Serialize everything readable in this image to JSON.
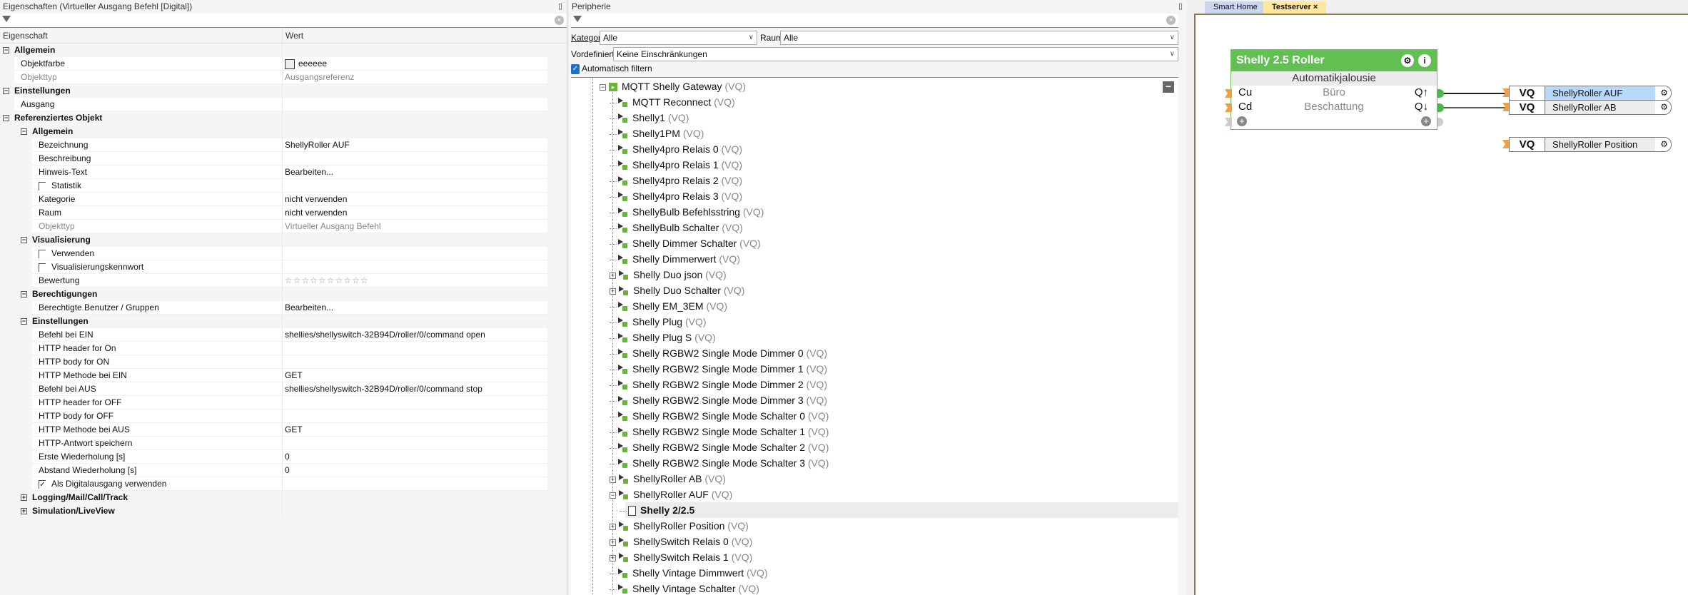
{
  "properties": {
    "title": "Eigenschaften (Virtueller Ausgang Befehl [Digital])",
    "col_property": "Eigenschaft",
    "col_value": "Wert",
    "rows": [
      {
        "type": "group",
        "level": 0,
        "label": "Allgemein",
        "toggle": "−"
      },
      {
        "type": "item",
        "level": 1,
        "label": "Objektfarbe",
        "value": "eeeeee",
        "swatch": "#eeeeee"
      },
      {
        "type": "item",
        "level": 1,
        "label": "Objekttyp",
        "value": "Ausgangsreferenz",
        "disabled": true
      },
      {
        "type": "group",
        "level": 0,
        "label": "Einstellungen",
        "toggle": "−"
      },
      {
        "type": "item",
        "level": 1,
        "label": "Ausgang",
        "value": ""
      },
      {
        "type": "group",
        "level": 0,
        "label": "Referenziertes Objekt",
        "toggle": "−"
      },
      {
        "type": "group",
        "level": 1,
        "label": "Allgemein",
        "toggle": "−"
      },
      {
        "type": "item",
        "level": 2,
        "label": "Bezeichnung",
        "value": "ShellyRoller AUF"
      },
      {
        "type": "item",
        "level": 2,
        "label": "Beschreibung",
        "value": ""
      },
      {
        "type": "item",
        "level": 2,
        "label": "Hinweis-Text",
        "value": "Bearbeiten..."
      },
      {
        "type": "item",
        "level": 2,
        "label": "Statistik",
        "value": "",
        "checkbox": false
      },
      {
        "type": "item",
        "level": 2,
        "label": "Kategorie",
        "value": "nicht verwenden"
      },
      {
        "type": "item",
        "level": 2,
        "label": "Raum",
        "value": "nicht verwenden"
      },
      {
        "type": "item",
        "level": 2,
        "label": "Objekttyp",
        "value": "Virtueller Ausgang Befehl",
        "disabled": true
      },
      {
        "type": "group",
        "level": 1,
        "label": "Visualisierung",
        "toggle": "−"
      },
      {
        "type": "item",
        "level": 2,
        "label": "Verwenden",
        "value": "",
        "checkbox": false
      },
      {
        "type": "item",
        "level": 2,
        "label": "Visualisierungskennwort",
        "value": "",
        "checkbox": false
      },
      {
        "type": "item",
        "level": 2,
        "label": "Bewertung",
        "value": "☆☆☆☆☆☆☆☆☆☆",
        "stars": true
      },
      {
        "type": "group",
        "level": 1,
        "label": "Berechtigungen",
        "toggle": "−"
      },
      {
        "type": "item",
        "level": 2,
        "label": "Berechtigte Benutzer / Gruppen",
        "value": "Bearbeiten..."
      },
      {
        "type": "group",
        "level": 1,
        "label": "Einstellungen",
        "toggle": "−"
      },
      {
        "type": "item",
        "level": 2,
        "label": "Befehl bei EIN",
        "value": "shellies/shellyswitch-32B94D/roller/0/command open"
      },
      {
        "type": "item",
        "level": 2,
        "label": "HTTP header for On",
        "value": ""
      },
      {
        "type": "item",
        "level": 2,
        "label": "HTTP body for ON",
        "value": ""
      },
      {
        "type": "item",
        "level": 2,
        "label": "HTTP Methode bei EIN",
        "value": "GET"
      },
      {
        "type": "item",
        "level": 2,
        "label": "Befehl bei AUS",
        "value": "shellies/shellyswitch-32B94D/roller/0/command stop"
      },
      {
        "type": "item",
        "level": 2,
        "label": "HTTP header for OFF",
        "value": ""
      },
      {
        "type": "item",
        "level": 2,
        "label": "HTTP body for OFF",
        "value": ""
      },
      {
        "type": "item",
        "level": 2,
        "label": "HTTP Methode bei AUS",
        "value": "GET"
      },
      {
        "type": "item",
        "level": 2,
        "label": "HTTP-Antwort speichern",
        "value": ""
      },
      {
        "type": "item",
        "level": 2,
        "label": "Erste Wiederholung [s]",
        "value": "0"
      },
      {
        "type": "item",
        "level": 2,
        "label": "Abstand Wiederholung [s]",
        "value": "0"
      },
      {
        "type": "item",
        "level": 2,
        "label": "Als Digitalausgang verwenden",
        "value": "",
        "checkbox": true
      },
      {
        "type": "group",
        "level": 1,
        "label": "Logging/Mail/Call/Track",
        "toggle": "+"
      },
      {
        "type": "group",
        "level": 1,
        "label": "Simulation/LiveView",
        "toggle": "+"
      }
    ]
  },
  "periphery": {
    "title": "Peripherie",
    "kategorie_label": "Kategorie:",
    "kategorie_value": "Alle",
    "raum_label": "Raum:",
    "raum_value": "Alle",
    "filter_label": "Vordefinierte Filter",
    "filter_value": "Keine Einschränkungen",
    "auto_filter_label": "Automatisch filtern",
    "auto_filter_checked": true,
    "tree_root": {
      "label": "MQTT Shelly Gateway",
      "suffix": "(VQ)"
    },
    "tree": [
      {
        "label": "MQTT Reconnect",
        "suffix": "(VQ)"
      },
      {
        "label": "Shelly1",
        "suffix": "(VQ)"
      },
      {
        "label": "Shelly1PM",
        "suffix": "(VQ)"
      },
      {
        "label": "Shelly4pro Relais 0",
        "suffix": "(VQ)"
      },
      {
        "label": "Shelly4pro Relais 1",
        "suffix": "(VQ)"
      },
      {
        "label": "Shelly4pro Relais 2",
        "suffix": "(VQ)"
      },
      {
        "label": "Shelly4pro Relais 3",
        "suffix": "(VQ)"
      },
      {
        "label": "ShellyBulb Befehlsstring",
        "suffix": "(VQ)"
      },
      {
        "label": "ShellyBulb Schalter",
        "suffix": "(VQ)"
      },
      {
        "label": "Shelly Dimmer Schalter",
        "suffix": "(VQ)"
      },
      {
        "label": "Shelly Dimmerwert",
        "suffix": "(VQ)"
      },
      {
        "label": "Shelly Duo json",
        "suffix": "(VQ)",
        "toggle": "+"
      },
      {
        "label": "Shelly Duo Schalter",
        "suffix": "(VQ)",
        "toggle": "+"
      },
      {
        "label": "Shelly EM_3EM",
        "suffix": "(VQ)"
      },
      {
        "label": "Shelly Plug",
        "suffix": "(VQ)"
      },
      {
        "label": "Shelly Plug S",
        "suffix": "(VQ)"
      },
      {
        "label": "Shelly RGBW2 Single Mode Dimmer 0",
        "suffix": "(VQ)"
      },
      {
        "label": "Shelly RGBW2 Single Mode Dimmer 1",
        "suffix": "(VQ)"
      },
      {
        "label": "Shelly RGBW2 Single Mode Dimmer 2",
        "suffix": "(VQ)"
      },
      {
        "label": "Shelly RGBW2 Single Mode Dimmer 3",
        "suffix": "(VQ)"
      },
      {
        "label": "Shelly RGBW2 Single Mode Schalter 0",
        "suffix": "(VQ)"
      },
      {
        "label": "Shelly RGBW2 Single Mode Schalter 1",
        "suffix": "(VQ)"
      },
      {
        "label": "Shelly RGBW2 Single Mode Schalter 2",
        "suffix": "(VQ)"
      },
      {
        "label": "Shelly RGBW2 Single Mode Schalter 3",
        "suffix": "(VQ)"
      },
      {
        "label": "ShellyRoller AB",
        "suffix": "(VQ)",
        "toggle": "+"
      },
      {
        "label": "ShellyRoller AUF",
        "suffix": "(VQ)",
        "toggle": "−"
      },
      {
        "label": "Shelly 2/2.5",
        "suffix": "",
        "child": true,
        "selected": true
      },
      {
        "label": "ShellyRoller Position",
        "suffix": "(VQ)",
        "toggle": "+"
      },
      {
        "label": "ShellySwitch Relais 0",
        "suffix": "(VQ)",
        "toggle": "+"
      },
      {
        "label": "ShellySwitch Relais 1",
        "suffix": "(VQ)",
        "toggle": "+"
      },
      {
        "label": "Shelly Vintage Dimmwert",
        "suffix": "(VQ)"
      },
      {
        "label": "Shelly Vintage Schalter",
        "suffix": "(VQ)"
      }
    ]
  },
  "editor": {
    "tabs": [
      {
        "label": "Smart Home",
        "active": false
      },
      {
        "label": "Testserver",
        "active": true,
        "close": "×"
      }
    ],
    "block": {
      "title": "Shelly 2.5 Roller",
      "subtitle": "Automatikjalousie",
      "in1": "Cu",
      "in2": "Cd",
      "mid1": "Büro",
      "mid2": "Beschattung",
      "out1": "Q↑",
      "out2": "Q↓",
      "add": "+"
    },
    "vq": [
      {
        "type": "VQ",
        "name": "ShellyRoller AUF",
        "selected": true
      },
      {
        "type": "VQ",
        "name": "ShellyRoller AB"
      },
      {
        "type": "VQ",
        "name": "ShellyRoller Position"
      }
    ]
  }
}
